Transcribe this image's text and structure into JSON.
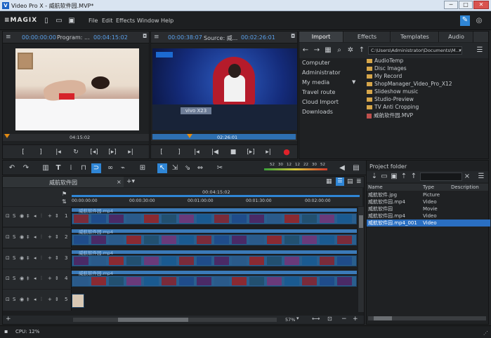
{
  "window": {
    "title": "Video Pro X - 威航软件园.MVP*",
    "btn_min": "─",
    "btn_max": "□",
    "btn_close": "✕"
  },
  "menubar": {
    "logo": "≡MAGIX",
    "items": [
      "File",
      "Edit",
      "Effects",
      "Window",
      "Help"
    ]
  },
  "program_monitor": {
    "tc_start": "00:00:00:00",
    "title": "Program: ...",
    "tc_end": "00:04:15:02",
    "scrub_time": "04:15:02"
  },
  "source_monitor": {
    "tc_start": "00:00:38:07",
    "title": "Source: 威...",
    "tc_end": "00:02:26:01",
    "scrub_time": "02:26:01"
  },
  "media_tabs": [
    "Import",
    "Effects",
    "Templates",
    "Audio"
  ],
  "media_path": "C:\\Users\\Administrator\\Documents\\M...",
  "media_nav": [
    "Computer",
    "Administrator",
    "My media",
    "Travel route",
    "Cloud Import",
    "Downloads"
  ],
  "media_files": [
    {
      "name": "AudioTemp",
      "kind": "folder"
    },
    {
      "name": "Disc Images",
      "kind": "folder"
    },
    {
      "name": "My Record",
      "kind": "folder"
    },
    {
      "name": "ShopManager_Video_Pro_X12",
      "kind": "folder"
    },
    {
      "name": "Slideshow music",
      "kind": "folder"
    },
    {
      "name": "Studio-Preview",
      "kind": "folder"
    },
    {
      "name": "TV Anti Cropping",
      "kind": "folder"
    },
    {
      "name": "威航软件园.MVP",
      "kind": "project"
    }
  ],
  "timeline": {
    "tab": "威航软件园",
    "ruler_time": "00:04:15:02",
    "ruler_ticks": [
      "00:00:00:00",
      "00:00:30:00",
      "00:01:00:00",
      "00:01:30:00",
      "00:02:00:00"
    ],
    "meter_ticks": [
      "52",
      "30",
      "12",
      "12",
      "22",
      "30",
      "52"
    ],
    "zoom": "57%",
    "tracks": [
      {
        "num": "1",
        "clip": "威航软件园.mp4"
      },
      {
        "num": "2",
        "clip": "威航软件园.mp4"
      },
      {
        "num": "3",
        "clip": "威航软件园.mp4"
      },
      {
        "num": "4",
        "clip": "威航软件园.mp4"
      },
      {
        "num": "5",
        "clip": ""
      }
    ]
  },
  "project_folder": {
    "title": "Project folder",
    "columns": [
      "Name",
      "Type",
      "Description"
    ],
    "rows": [
      {
        "name": "威航软件.jpg",
        "type": "Picture",
        "desc": ""
      },
      {
        "name": "威航软件园.mp4",
        "type": "Video",
        "desc": ""
      },
      {
        "name": "威航软件园",
        "type": "Movie",
        "desc": ""
      },
      {
        "name": "威航软件园.mp4",
        "type": "Video",
        "desc": ""
      },
      {
        "name": "威航软件园.mp4_001",
        "type": "Video",
        "desc": "",
        "selected": true
      }
    ]
  },
  "status": {
    "cpu": "CPU: 12%"
  },
  "colors": {
    "accent": "#2f86d6",
    "timecode": "#5aa0ea",
    "clip": "#2a5f8e",
    "selected": "#2a6fc2",
    "record": "#e0222a"
  }
}
